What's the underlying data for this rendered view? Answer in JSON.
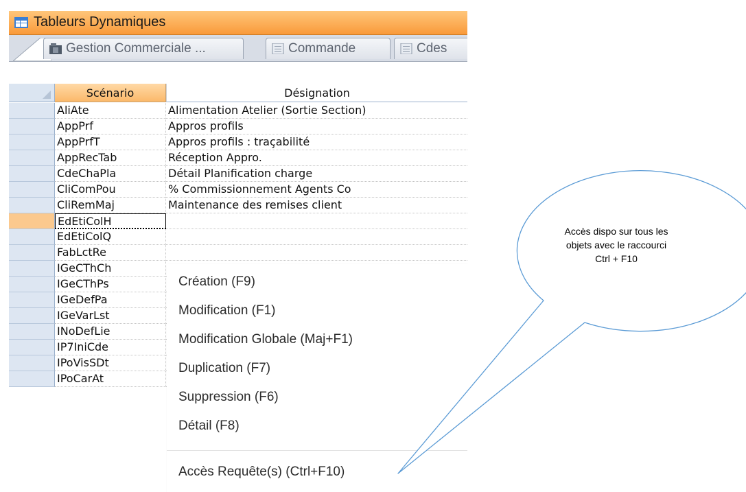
{
  "window": {
    "title": "Tableurs Dynamiques"
  },
  "tabs": [
    {
      "label": "Gestion Commerciale ...",
      "icon": "folder-db-icon"
    },
    {
      "label": "Commande",
      "icon": "document-icon"
    },
    {
      "label": "Cdes",
      "icon": "document-icon"
    }
  ],
  "grid": {
    "columns": {
      "scenario": "Scénario",
      "designation": "Désignation"
    },
    "rows": [
      {
        "scenario": "AliAte",
        "designation": "Alimentation Atelier (Sortie Section)"
      },
      {
        "scenario": "AppPrf",
        "designation": "Appros profils"
      },
      {
        "scenario": "AppPrfT",
        "designation": "Appros profils : traçabilité"
      },
      {
        "scenario": "AppRecTab",
        "designation": "Réception Appro."
      },
      {
        "scenario": "CdeChaPla",
        "designation": "Détail Planification charge"
      },
      {
        "scenario": "CliComPou",
        "designation": "% Commissionnement Agents Co"
      },
      {
        "scenario": "CliRemMaj",
        "designation": "Maintenance des remises client"
      },
      {
        "scenario": "EdEtiColH",
        "designation": ""
      },
      {
        "scenario": "EdEtiColQ",
        "designation": ""
      },
      {
        "scenario": "FabLctRe",
        "designation": ""
      },
      {
        "scenario": "IGeCThCh",
        "designation": ""
      },
      {
        "scenario": "IGeCThPs",
        "designation": ""
      },
      {
        "scenario": "IGeDefPa",
        "designation": ""
      },
      {
        "scenario": "IGeVarLst",
        "designation": ""
      },
      {
        "scenario": "INoDefLie",
        "designation": ""
      },
      {
        "scenario": "IP7IniCde",
        "designation": ""
      },
      {
        "scenario": "IPoVisSDt",
        "designation": ""
      },
      {
        "scenario": "IPoCarAt",
        "designation": ""
      }
    ]
  },
  "context_menu": {
    "items": [
      "Création (F9)",
      "Modification (F1)",
      "Modification Globale (Maj+F1)",
      "Duplication (F7)",
      "Suppression (F6)",
      "Détail (F8)",
      "Accès Requête(s) (Ctrl+F10)"
    ]
  },
  "callout": {
    "lines": [
      "Accès dispo sur tous les",
      "objets avec le raccourci",
      "Ctrl + F10"
    ]
  },
  "colors": {
    "titlebar": "#f99a3a",
    "selected_row_marker": "#fbc98e",
    "row_selector": "#dde6f2",
    "callout_stroke": "#5b9bd5"
  }
}
